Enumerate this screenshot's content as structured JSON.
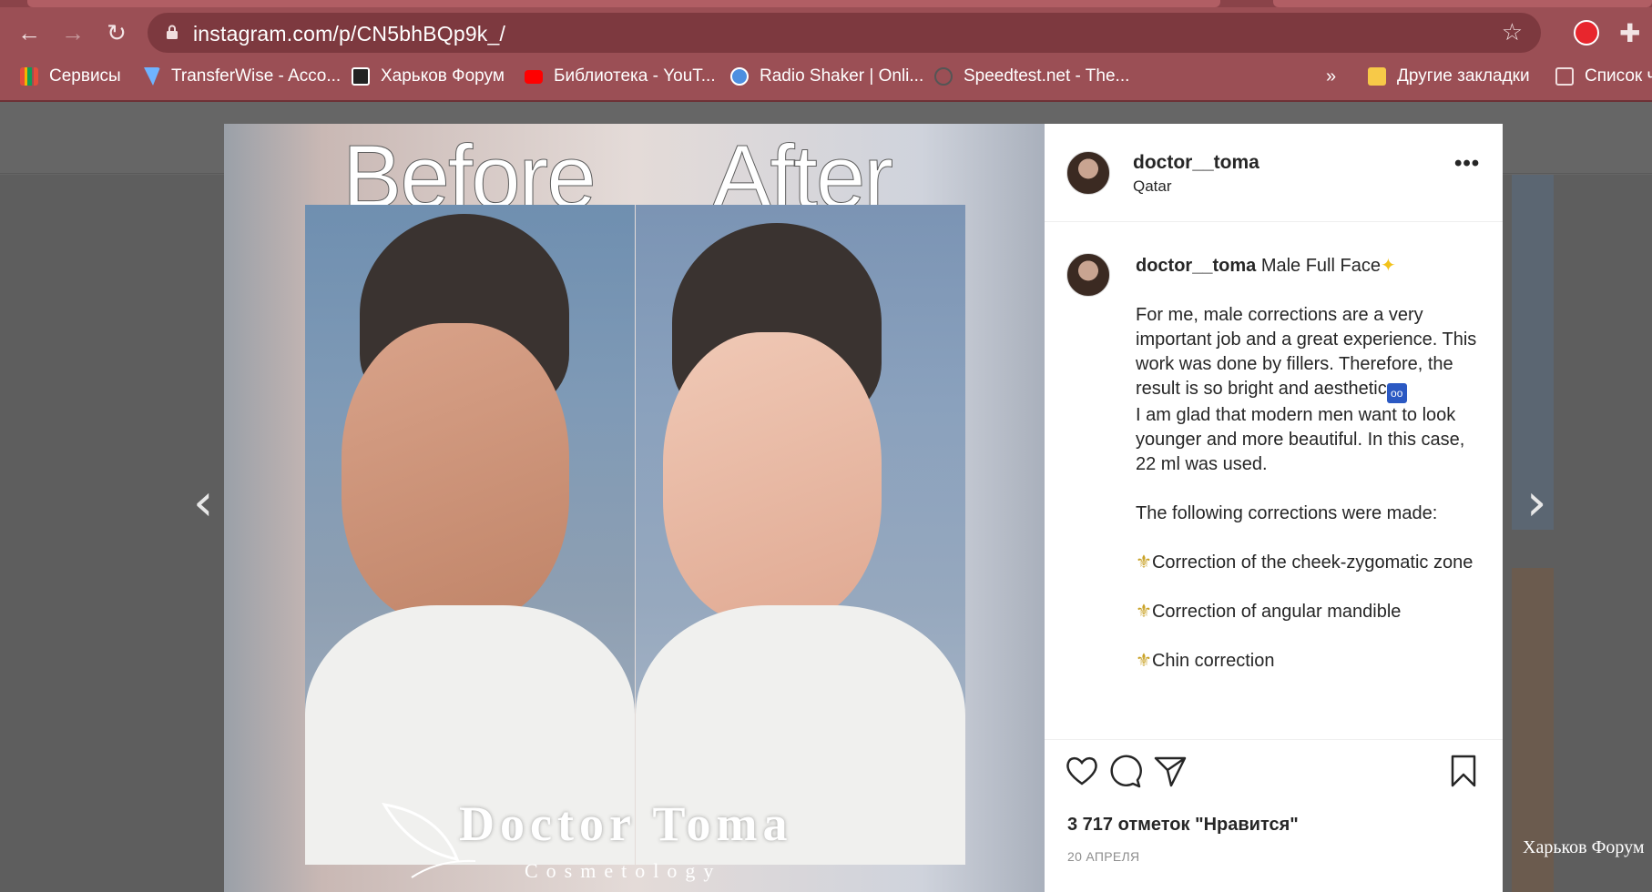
{
  "browser": {
    "url": "instagram.com/p/CN5bhBQp9k_/",
    "nav": {
      "back": "←",
      "forward": "→",
      "reload": "↻"
    },
    "star_icon": "☆",
    "bookmarks": [
      {
        "label": "Сервисы",
        "icon": "apps-grid-icon",
        "color": "#e44d3a"
      },
      {
        "label": "TransferWise - Acco...",
        "icon": "transferwise-icon",
        "color": "#6fb3ff"
      },
      {
        "label": "Харьков Форум",
        "icon": "forum-icon",
        "color": "#222222"
      },
      {
        "label": "Библиотека - YouT...",
        "icon": "youtube-icon",
        "color": "#ff0000"
      },
      {
        "label": "Radio Shaker | Onli...",
        "icon": "radio-icon",
        "color": "#4d8fe0"
      },
      {
        "label": "Speedtest.net - The...",
        "icon": "speedtest-icon",
        "color": "#555555"
      }
    ],
    "overflow": "»",
    "other_bookmarks": "Другие закладки",
    "reading_list": "Список ч"
  },
  "post": {
    "image": {
      "before_label": "Before",
      "after_label": "After",
      "brand_name": "Doctor Toma",
      "brand_sub": "Cosmetology"
    },
    "author": {
      "username": "doctor__toma",
      "location": "Qatar"
    },
    "caption": {
      "username": "doctor__toma",
      "title": "Male Full Face",
      "paragraph1": "For me, male corrections are a very important job and a great experience. This work was done by fillers. Therefore, the result is so bright and aesthetic",
      "emoji1": "🆒",
      "paragraph2": "I am glad that modern men want to look younger and more beautiful. In this case, 22 ml was used.",
      "paragraph3": "The following corrections were made:",
      "item1": "Correction of the cheek-zygomatic zone",
      "item2": "Correction of angular mandible",
      "item3": "Chin correction"
    },
    "likes": "3 717 отметок \"Нравится\"",
    "date": "20 АПРЕЛЯ",
    "more": "•••"
  },
  "page": {
    "prev_arrow": "‹",
    "next_arrow": "›",
    "watermark": "Харьков Форум"
  },
  "colors": {
    "chrome": "#9b4f55",
    "omnibox": "#7d393f",
    "panel_text": "#262626",
    "muted": "#8e8e8e"
  }
}
